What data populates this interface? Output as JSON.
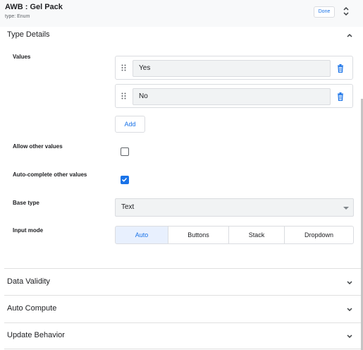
{
  "header": {
    "title": "AWB : Gel Pack",
    "subtitle": "type: Enum",
    "done_label": "Done"
  },
  "type_details": {
    "label": "Type Details",
    "values_label": "Values",
    "values": [
      "Yes",
      "No"
    ],
    "add_label": "Add",
    "allow_other_label": "Allow other values",
    "allow_other_checked": false,
    "autocomplete_label": "Auto-complete other values",
    "autocomplete_checked": true,
    "base_type_label": "Base type",
    "base_type_value": "Text",
    "input_mode_label": "Input mode",
    "input_modes": [
      "Auto",
      "Buttons",
      "Stack",
      "Dropdown"
    ],
    "input_mode_selected": "Auto"
  },
  "sections": [
    {
      "label": "Data Validity"
    },
    {
      "label": "Auto Compute"
    },
    {
      "label": "Update Behavior"
    }
  ],
  "colors": {
    "accent": "#1a73e8",
    "field_bg": "#f1f3f4",
    "header_bg": "#f8f9fa"
  },
  "icons": [
    "chevron-up-down-icon",
    "chevron-up-icon",
    "drag-handle-icon",
    "trash-icon",
    "check-icon",
    "chevron-down-icon",
    "dropdown-arrow-icon"
  ]
}
